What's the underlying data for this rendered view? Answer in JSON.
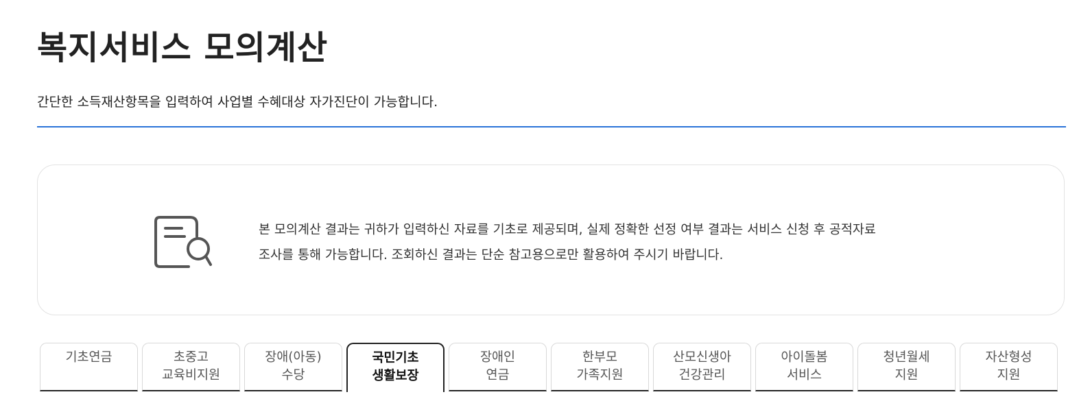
{
  "header": {
    "title": "복지서비스 모의계산",
    "subtitle": "간단한 소득재산항목을 입력하여 사업별 수혜대상 자가진단이 가능합니다."
  },
  "notice": {
    "icon": "document-search-icon",
    "line1": "본 모의계산 결과는 귀하가 입력하신 자료를 기초로 제공되며, 실제 정확한 선정 여부 결과는 서비스 신청 후 공적자료",
    "line2": "조사를 통해 가능합니다. 조회하신 결과는 단순 참고용으로만 활용하여 주시기 바랍니다."
  },
  "tabs": [
    {
      "line1": "기초연금",
      "line2": ""
    },
    {
      "line1": "초중고",
      "line2": "교육비지원"
    },
    {
      "line1": "장애(아동)",
      "line2": "수당"
    },
    {
      "line1": "국민기초",
      "line2": "생활보장",
      "active": true
    },
    {
      "line1": "장애인",
      "line2": "연금"
    },
    {
      "line1": "한부모",
      "line2": "가족지원"
    },
    {
      "line1": "산모신생아",
      "line2": "건강관리"
    },
    {
      "line1": "아이돌봄",
      "line2": "서비스"
    },
    {
      "line1": "청년월세",
      "line2": "지원"
    },
    {
      "line1": "자산형성",
      "line2": "지원"
    }
  ],
  "colors": {
    "accent": "#2a72d8",
    "tab_border_active": "#222222"
  }
}
